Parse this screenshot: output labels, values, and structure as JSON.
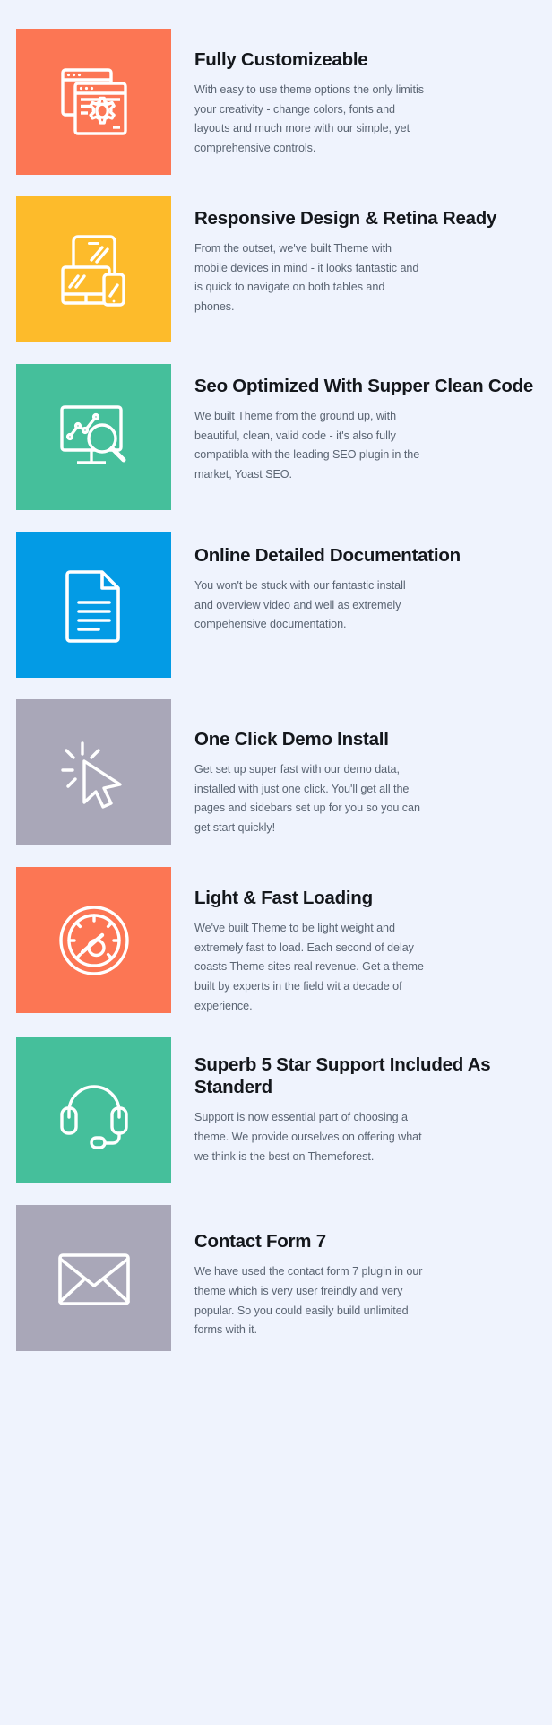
{
  "page": {
    "background_color": "#eff3fd",
    "title_color": "#14171c",
    "text_color": "#5a6472"
  },
  "features": [
    {
      "icon_name": "browser-windows-gear-icon",
      "tile_color": "#fc7654",
      "title": "Fully Customizeable",
      "description": "With easy to use theme options the only limitis your creativity - change colors, fonts and layouts and much more with our simple, yet comprehensive controls."
    },
    {
      "icon_name": "responsive-devices-icon",
      "tile_color": "#fdbb2b",
      "title": "Responsive Design & Retina Ready",
      "description": "From the outset, we've built Theme with mobile devices in mind - it looks fantastic and is quick to navigate on both tables and phones."
    },
    {
      "icon_name": "seo-monitor-magnifier-icon",
      "tile_color": "#45bf9b",
      "title": "Seo Optimized With Supper Clean Code",
      "description": "We built Theme from the ground up, with beautiful, clean, valid code - it's also fully compatibla with the leading SEO plugin in the market, Yoast SEO."
    },
    {
      "icon_name": "document-page-icon",
      "tile_color": "#039be5",
      "title": "Online Detailed Documentation",
      "description": "You won't be stuck with our fantastic install and overview video and well as extremely compehensive documentation."
    },
    {
      "icon_name": "mouse-cursor-click-icon",
      "tile_color": "#a9a7b8",
      "title": "One Click Demo Install",
      "description": "Get set up super fast with our demo data, installed with just one click. You'll get all the pages and sidebars set up for you so you can get start quickly!"
    },
    {
      "icon_name": "speedometer-gauge-icon",
      "tile_color": "#fc7654",
      "title": "Light & Fast Loading",
      "description": "We've built Theme to be light weight and extremely fast to load. Each second of delay coasts Theme sites real revenue. Get a theme built by experts in the field wit a decade of experience."
    },
    {
      "icon_name": "headset-support-icon",
      "tile_color": "#45bf9b",
      "title": "Superb 5 Star Support Included As Standerd",
      "description": "Support is now essential part of choosing a theme. We provide ourselves on offering what we think is the best on Themeforest."
    },
    {
      "icon_name": "envelope-mail-icon",
      "tile_color": "#a9a7b8",
      "title": "Contact Form 7",
      "description": "We have used the contact form 7 plugin in our theme which is very user freindly and very popular. So you could easily build unlimited forms with it."
    }
  ]
}
